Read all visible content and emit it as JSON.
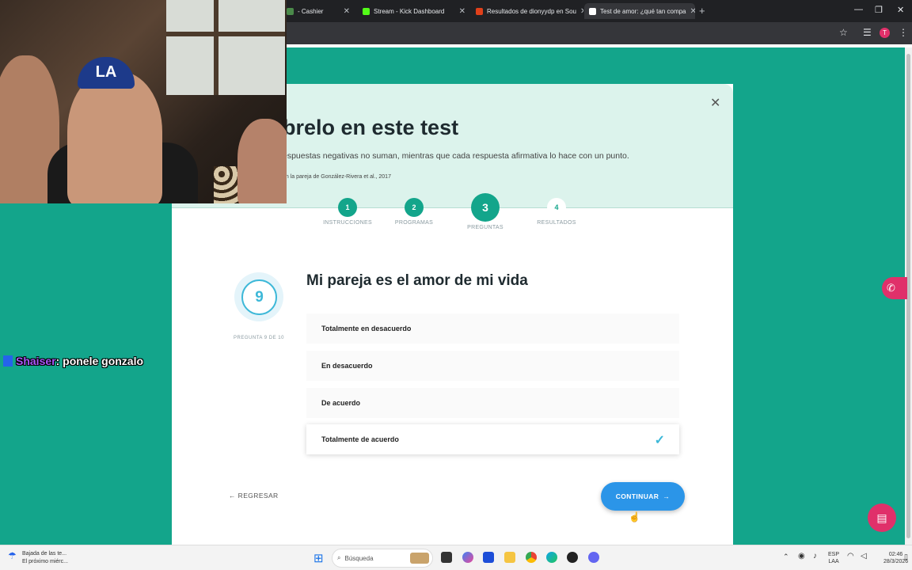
{
  "browser": {
    "tabs": [
      {
        "title": "- Cashier",
        "color": "#4a8a4a"
      },
      {
        "title": "Stream - Kick Dashboard",
        "color": "#53fc18"
      },
      {
        "title": "Resultados de dionyydp en Sou",
        "color": "#e0401a"
      },
      {
        "title": "Test de amor: ¿qué tan compa",
        "color": "#ffffff"
      }
    ],
    "new_tab": "+",
    "avatar_letter": "T"
  },
  "modal": {
    "header_title": "brelo en este test",
    "header_subtitle": "espuestas negativas no suman, mientras que cada respuesta afirmativa lo hace con un punto.",
    "header_citation": "on la pareja de González-Rivera et al., 2017",
    "steps": [
      {
        "number": "1",
        "label": "INSTRUCCIONES",
        "state": "done"
      },
      {
        "number": "2",
        "label": "PROGRAMAS",
        "state": "done"
      },
      {
        "number": "3",
        "label": "PREGUNTAS",
        "state": "current"
      },
      {
        "number": "4",
        "label": "RESULTADOS",
        "state": "pending"
      }
    ],
    "question_number": "9",
    "question_caption": "PREGUNTA 9 DE 10",
    "question": "Mi pareja es el amor de mi vida",
    "options": [
      {
        "label": "Totalmente en desacuerdo",
        "selected": false
      },
      {
        "label": "En desacuerdo",
        "selected": false
      },
      {
        "label": "De acuerdo",
        "selected": false
      },
      {
        "label": "Totalmente de acuerdo",
        "selected": true
      }
    ],
    "back_label": "REGRESAR",
    "continue_label": "CONTINUAR"
  },
  "overlay": {
    "chat_user": "Shaiser",
    "chat_message": ": ponele gonzalo",
    "cap_text": "LA"
  },
  "taskbar": {
    "weather_line1": "Bajada de las te...",
    "weather_line2": "El próximo miérc...",
    "search_placeholder": "Búsqueda",
    "lang_line1": "ESP",
    "lang_line2": "LAA",
    "time": "02:46",
    "date": "28/3/2026"
  },
  "colors": {
    "page_bg": "#13a58b",
    "accent_teal": "#13a58b",
    "accent_blue": "#2b95e8",
    "pink": "#e0306a",
    "check": "#3db8d8"
  }
}
